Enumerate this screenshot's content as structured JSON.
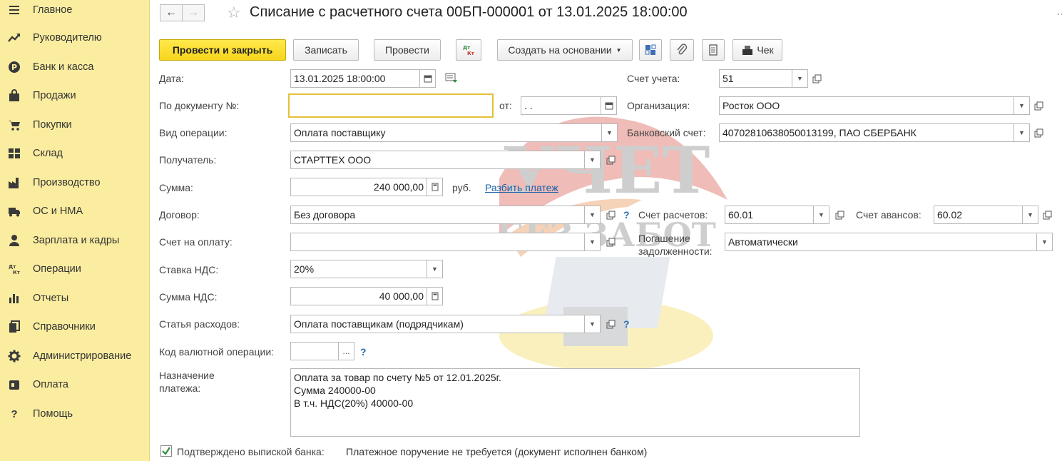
{
  "sidebar": {
    "items": [
      {
        "label": "Главное",
        "icon": "menu-icon"
      },
      {
        "label": "Руководителю",
        "icon": "trend-chart-icon"
      },
      {
        "label": "Банк и касса",
        "icon": "ruble-coin-icon"
      },
      {
        "label": "Продажи",
        "icon": "shopping-bag-icon"
      },
      {
        "label": "Покупки",
        "icon": "shopping-cart-icon"
      },
      {
        "label": "Склад",
        "icon": "warehouse-grid-icon"
      },
      {
        "label": "Производство",
        "icon": "factory-icon"
      },
      {
        "label": "ОС и НМА",
        "icon": "truck-icon"
      },
      {
        "label": "Зарплата и кадры",
        "icon": "person-icon"
      },
      {
        "label": "Операции",
        "icon": "debit-credit-icon"
      },
      {
        "label": "Отчеты",
        "icon": "bar-chart-icon"
      },
      {
        "label": "Справочники",
        "icon": "books-icon"
      },
      {
        "label": "Администрирование",
        "icon": "gear-icon"
      },
      {
        "label": "Оплата",
        "icon": "wallet-icon"
      },
      {
        "label": "Помощь",
        "icon": "question-icon"
      }
    ]
  },
  "header": {
    "title": "Списание с расчетного счета 00БП-000001 от 13.01.2025 18:00:00"
  },
  "toolbar": {
    "post_close": "Провести и закрыть",
    "save": "Записать",
    "post": "Провести",
    "dt_kt": "Дт Кт",
    "create_based": "Создать на основании",
    "receipt": "Чек"
  },
  "form": {
    "date_label": "Дата:",
    "date_value": "13.01.2025 18:00:00",
    "doc_no_label": "По документу №:",
    "doc_no_value": "",
    "from_label": "от:",
    "from_value": "  .  .",
    "op_type_label": "Вид операции:",
    "op_type_value": "Оплата поставщику",
    "recipient_label": "Получатель:",
    "recipient_value": "СТАРТТЕХ ООО",
    "sum_label": "Сумма:",
    "sum_value": "240 000,00",
    "currency": "руб.",
    "split_link": "Разбить платеж",
    "contract_label": "Договор:",
    "contract_value": "Без договора",
    "invoice_label": "Счет на оплату:",
    "invoice_value": "",
    "vat_rate_label": "Ставка НДС:",
    "vat_rate_value": "20%",
    "vat_sum_label": "Сумма НДС:",
    "vat_sum_value": "40 000,00",
    "expense_label": "Статья расходов:",
    "expense_value": "Оплата поставщикам (подрядчикам)",
    "currency_op_label": "Код валютной операции:",
    "currency_op_value": "",
    "purpose_label_1": "Назначение",
    "purpose_label_2": "платежа:",
    "purpose_value": "Оплата за товар по счету №5 от 12.01.2025г.\nСумма 240000-00\nВ т.ч. НДС(20%) 40000-00",
    "account_label": "Счет учета:",
    "account_value": "51",
    "org_label": "Организация:",
    "org_value": "Росток ООО",
    "bank_acc_label": "Банковский счет:",
    "bank_acc_value": "40702810638050013199, ПАО СБЕРБАНК",
    "settle_acc_label": "Счет расчетов:",
    "settle_acc_value": "60.01",
    "advance_acc_label": "Счет авансов:",
    "advance_acc_value": "60.02",
    "debt_label_1": "Погашение",
    "debt_label_2": "задолженности:",
    "debt_value": "Автоматически",
    "help_mark": "?",
    "ellipsis": "..."
  },
  "footer": {
    "confirmed_label": "Подтверждено выпиской банка:",
    "confirmed_checked": true,
    "order_note": "Платежное поручение не требуется (документ исполнен банком)"
  },
  "watermark": {
    "line1": "УЧЕТ",
    "line2": "БЕЗ ЗАБОТ"
  },
  "colors": {
    "sidebar_bg": "#fbeda0",
    "primary_button": "#f7d51d",
    "link": "#1a5fa8",
    "focus_border": "#e3c13a"
  }
}
